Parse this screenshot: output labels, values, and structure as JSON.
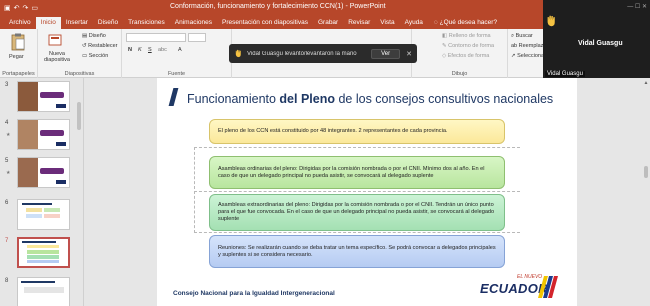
{
  "window": {
    "title": "Conformación, funcionamiento y fortalecimiento CCN(1) - PowerPoint"
  },
  "tabs": [
    {
      "label": "Archivo"
    },
    {
      "label": "Inicio"
    },
    {
      "label": "Insertar"
    },
    {
      "label": "Diseño"
    },
    {
      "label": "Transiciones"
    },
    {
      "label": "Animaciones"
    },
    {
      "label": "Presentación con diapositivas"
    },
    {
      "label": "Grabar"
    },
    {
      "label": "Revisar"
    },
    {
      "label": "Vista"
    },
    {
      "label": "Ayuda"
    }
  ],
  "tell_me": "¿Qué desea hacer?",
  "ribbon": {
    "clipboard": {
      "paste": "Pegar",
      "label": "Portapapeles"
    },
    "slides": {
      "new_slide": "Nueva diapositiva",
      "layout": "Diseño",
      "reset": "Restablecer",
      "section": "Sección",
      "label": "Diapositivas"
    },
    "font": {
      "label": "Fuente"
    },
    "drawing": {
      "fill": "Relleno de forma",
      "outline": "Contorno de forma",
      "effects": "Efectos de forma",
      "label": "Dibujo"
    },
    "editing": {
      "find": "Buscar",
      "replace": "Reemplazar",
      "select": "Seleccionar"
    }
  },
  "toast": {
    "message": "Vidal Guasgu levantó/levantaron la mano",
    "button": "Ver"
  },
  "video": {
    "name": "Vidal Guasgu",
    "label": "Vidal Guasgu"
  },
  "thumbnails": [
    {
      "number": "3"
    },
    {
      "number": "4"
    },
    {
      "number": "5"
    },
    {
      "number": "6"
    },
    {
      "number": "7"
    },
    {
      "number": "8"
    }
  ],
  "slide": {
    "title_prefix": "Funcionamiento ",
    "title_bold": "del Pleno",
    "title_suffix": " de los consejos consultivos nacionales",
    "boxes": [
      "El pleno de los CCN está constituido por 48 integrantes. 2 representantes de cada provincia.",
      "Asambleas ordinarias del pleno: Dirigidas por la comisión nombrada o por el CNII. Mínimo dos al año. En el caso de que un delegado principal no pueda asistir, se convocará al delegado suplente",
      "Asambleas extraordinarias del pleno: Dirigidas por la comisión nombrada o por el CNII. Tendrán un único punto para el que fue convocada. En el caso de que un delegado principal no pueda asistir, se convocará al delegado suplente",
      "Reuniones: Se realizarán cuando se deba tratar un tema específico. Se podrá convocar a delegados principales y suplentes si se considera necesario."
    ],
    "footer": "Consejo Nacional para la Igualdad Intergeneracional",
    "logo_top": "EL NUEVO",
    "logo_word": "ECUADOR"
  }
}
